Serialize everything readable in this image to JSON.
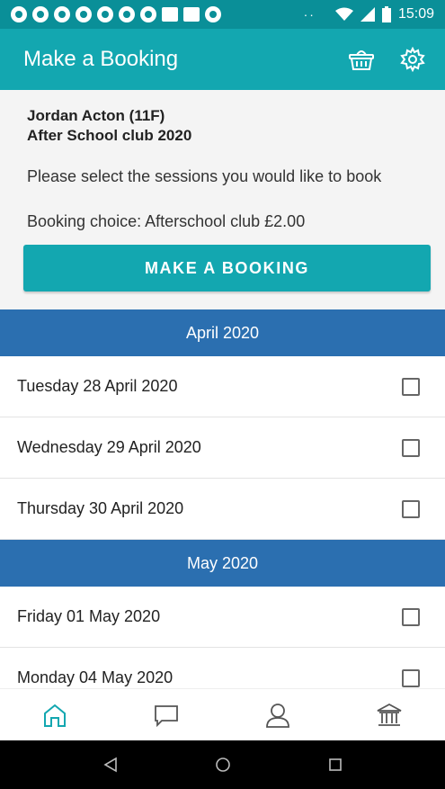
{
  "status_bar": {
    "time": "15:09",
    "notification_icons": [
      "chrome-icon",
      "chrome-icon",
      "chrome-icon",
      "chrome-icon",
      "chrome-icon",
      "chrome-icon",
      "chrome-icon",
      "gmail-icon",
      "image-icon",
      "whatsapp-icon"
    ],
    "more_indicator": "··"
  },
  "app_bar": {
    "title": "Make a Booking",
    "actions": [
      "basket-icon",
      "gear-icon"
    ]
  },
  "info": {
    "student_name": "Jordan Acton (11F)",
    "club_name": "After School club 2020",
    "prompt": "Please select the sessions you would like to book",
    "booking_choice": "Booking choice: Afterschool club £2.00",
    "button_label": "MAKE A BOOKING"
  },
  "months": [
    {
      "label": "April 2020",
      "days": [
        {
          "label": "Tuesday 28 April 2020",
          "checked": false
        },
        {
          "label": "Wednesday 29 April 2020",
          "checked": false
        },
        {
          "label": "Thursday 30 April 2020",
          "checked": false
        }
      ]
    },
    {
      "label": "May 2020",
      "days": [
        {
          "label": "Friday 01 May 2020",
          "checked": false
        },
        {
          "label": "Monday 04 May 2020",
          "checked": false
        }
      ]
    }
  ],
  "bottom_nav": [
    "home-icon",
    "chat-icon",
    "profile-icon",
    "bank-icon"
  ],
  "system_nav": [
    "back-icon",
    "home-circle-icon",
    "recents-icon"
  ],
  "colors": {
    "status_bar": "#0a8f98",
    "app_bar": "#13a7b0",
    "month_header": "#2b6fb0",
    "accent": "#13a7b0"
  }
}
